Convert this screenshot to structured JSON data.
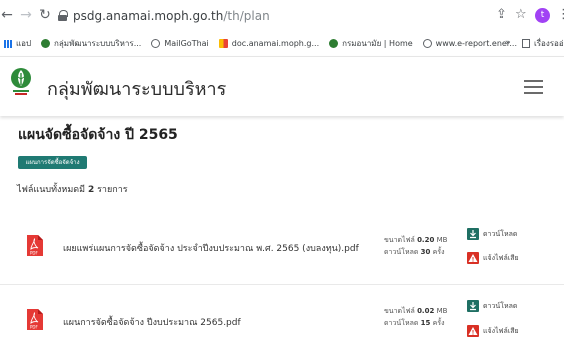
{
  "browser": {
    "url_domain": "psdg.anamai.moph.go.th",
    "url_path": "/th/plan",
    "back_icon": "back-arrow-icon",
    "forward_icon": "forward-arrow-icon",
    "reload_icon": "reload-icon",
    "profile_initial": "t"
  },
  "bookmarks": {
    "items": [
      {
        "label": "แอป",
        "icon": "apps-grid-icon",
        "color": "#1a73e8"
      },
      {
        "label": "กลุ่มพัฒนาระบบบริหาร...",
        "icon": "site-icon",
        "color": "#2e7d32"
      },
      {
        "label": "MailGoThai",
        "icon": "globe-icon",
        "color": "#5f6368"
      },
      {
        "label": "doc.anamai.moph.g...",
        "icon": "colorful-icon",
        "color": "#fbbc04"
      },
      {
        "label": "กรมอนามัย | Home",
        "icon": "site-icon",
        "color": "#2e7d32"
      },
      {
        "label": "www.e-report.ener...",
        "icon": "globe-icon",
        "color": "#5f6368"
      }
    ],
    "more": "»",
    "last_label": "เรื่องรออ่าน"
  },
  "site": {
    "title": "กลุ่มพัฒนาระบบบริหาร",
    "brand_color": "#1f7a73"
  },
  "page": {
    "heading": "แผนจัดซื้อจัดจ้าง ปี 2565",
    "tag_button": "แผนการจัดซื้อจัดจ้าง",
    "file_count_prefix": "ไฟล์แนบทั้งหมดมี",
    "file_count": "2",
    "file_count_suffix": "รายการ"
  },
  "files": [
    {
      "name": "เผยแพร่แผนการจัดซื้อจัดจ้าง ประจำปีงบประมาณ พ.ศ. 2565 (งบลงทุน).pdf",
      "size_label": "ขนาดไฟล์",
      "size": "0.20",
      "size_unit": "MB",
      "downloads_label": "ดาวน์โหลด",
      "downloads": "30",
      "downloads_unit": "ครั้ง",
      "download_action": "ดาวน์โหลด",
      "report_action": "แจ้งไฟล์เสีย"
    },
    {
      "name": "แผนการจัดซื้อจัดจ้าง ปีงบประมาณ 2565.pdf",
      "size_label": "ขนาดไฟล์",
      "size": "0.02",
      "size_unit": "MB",
      "downloads_label": "ดาวน์โหลด",
      "downloads": "15",
      "downloads_unit": "ครั้ง",
      "download_action": "ดาวน์โหลด",
      "report_action": "แจ้งไฟล์เสีย"
    }
  ]
}
